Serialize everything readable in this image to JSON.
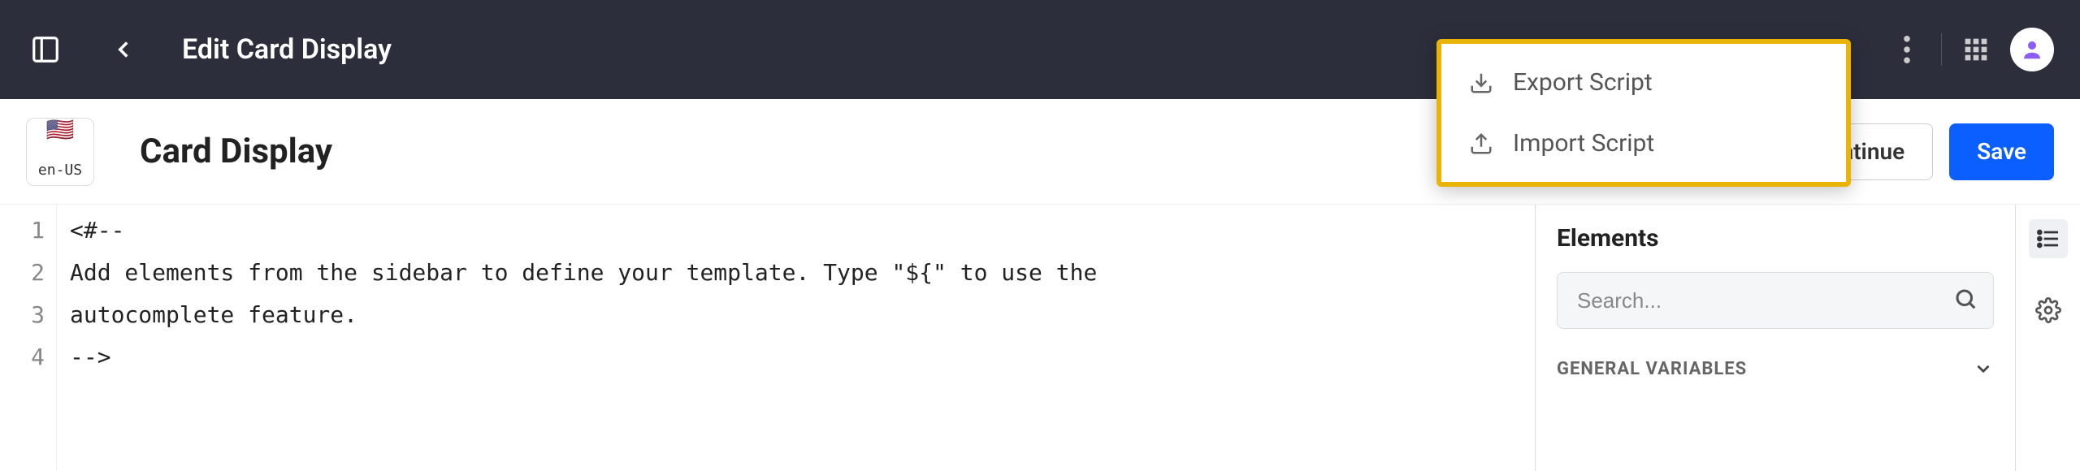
{
  "header": {
    "title": "Edit Card Display"
  },
  "menu": {
    "export_label": "Export Script",
    "import_label": "Import Script"
  },
  "subheader": {
    "locale_code": "en-US",
    "card_title": "Card Display",
    "continue_label": "Save and Continue",
    "save_label": "Save"
  },
  "code": {
    "lines": [
      "<#--",
      "Add elements from the sidebar to define your template. Type \"${\" to use the",
      "autocomplete feature.",
      "-->"
    ]
  },
  "sidebar": {
    "title": "Elements",
    "search_placeholder": "Search...",
    "section1": "GENERAL VARIABLES"
  }
}
